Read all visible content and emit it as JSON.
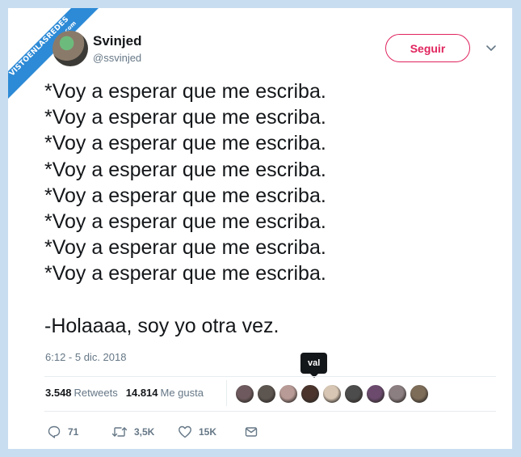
{
  "watermark": {
    "line1": "VISTOENLASREDES",
    "line2": ".com"
  },
  "user": {
    "name": "Svinjed",
    "handle": "@ssvinjed"
  },
  "follow_label": "Seguir",
  "tweet": {
    "text": "*Voy a esperar que me escriba.\n*Voy a esperar que me escriba.\n*Voy a esperar que me escriba.\n*Voy a esperar que me escriba.\n*Voy a esperar que me escriba.\n*Voy a esperar que me escriba.\n*Voy a esperar que me escriba.\n*Voy a esperar que me escriba.\n\n-Holaaaa, soy yo otra vez.",
    "timestamp": "6:12 - 5 dic. 2018"
  },
  "tooltip": "val",
  "stats": {
    "retweets_count": "3.548",
    "retweets_label": "Retweets",
    "likes_count": "14.814",
    "likes_label": "Me gusta"
  },
  "liker_avatars": [
    "#6e5a5e",
    "#5c5550",
    "#b89a96",
    "#4a342c",
    "#d7c6b3",
    "#4c4c4c",
    "#6b4a6e",
    "#8c7f82",
    "#7d6c58"
  ],
  "actions": {
    "replies": "71",
    "retweets": "3,5K",
    "likes": "15K"
  },
  "colors": {
    "background": "#c9ddf0",
    "accent": "#e0245e",
    "ribbon": "#2d8ad6",
    "muted": "#657786"
  }
}
